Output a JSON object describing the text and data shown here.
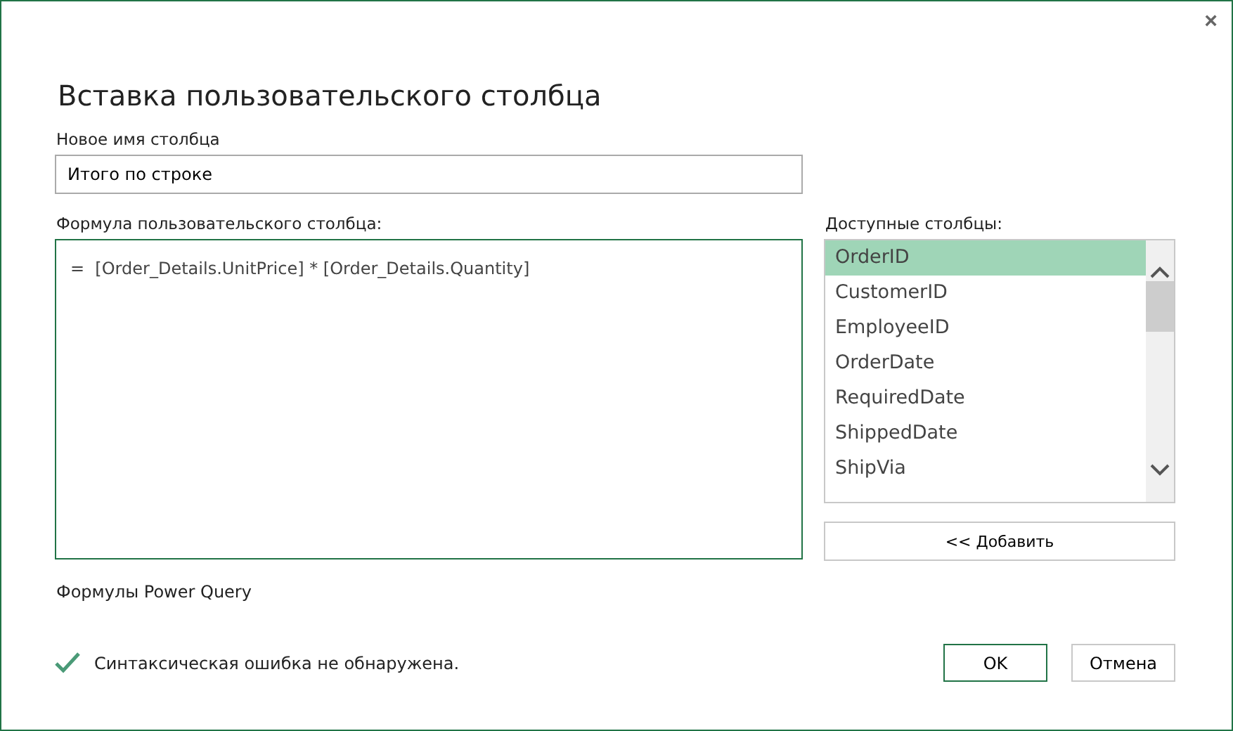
{
  "dialog": {
    "close": "×",
    "title": "Вставка пользовательского столбца"
  },
  "name_field": {
    "label": "Новое имя столбца",
    "value": "Итого по строке"
  },
  "formula": {
    "label": "Формула пользовательского столбца:",
    "value": "=  [Order_Details.UnitPrice] * [Order_Details.Quantity]"
  },
  "available_columns": {
    "label": "Доступные столбцы:",
    "items": [
      {
        "label": "OrderID",
        "selected": true
      },
      {
        "label": "CustomerID",
        "selected": false
      },
      {
        "label": "EmployeeID",
        "selected": false
      },
      {
        "label": "OrderDate",
        "selected": false
      },
      {
        "label": "RequiredDate",
        "selected": false
      },
      {
        "label": "ShippedDate",
        "selected": false
      },
      {
        "label": "ShipVia",
        "selected": false
      }
    ],
    "add_button": "<< Добавить"
  },
  "help_link": "Формулы Power Query",
  "status": {
    "ok": true,
    "text": "Синтаксическая ошибка не обнаружена."
  },
  "buttons": [
    {
      "label": "OK",
      "primary": true
    },
    {
      "label": "Отмена",
      "primary": false
    }
  ]
}
